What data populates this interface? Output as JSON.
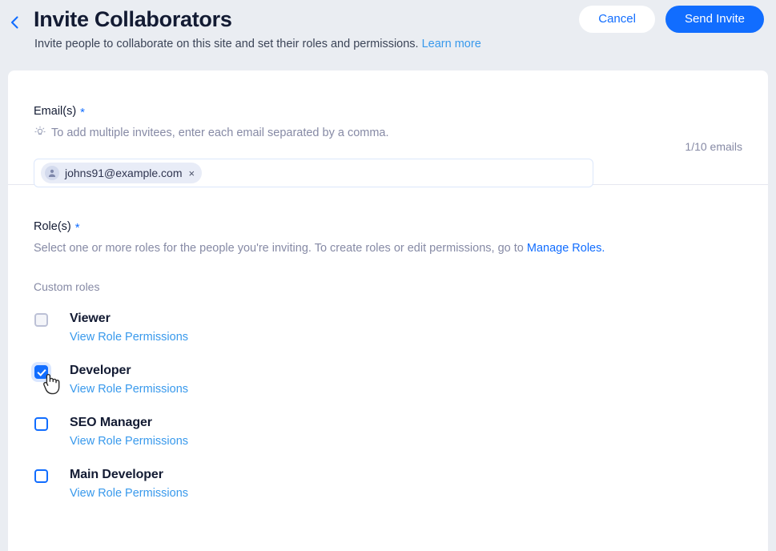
{
  "header": {
    "back_icon": "chevron-left-icon",
    "title": "Invite Collaborators",
    "subtitle": "Invite people to collaborate on this site and set their roles and permissions.",
    "learn_more_label": "Learn more",
    "cancel_label": "Cancel",
    "send_invite_label": "Send Invite"
  },
  "email_section": {
    "label": "Email(s)",
    "required_mark": "*",
    "hint_icon": "lightbulb-icon",
    "hint": "To add multiple invitees, enter each email separated by a comma.",
    "counter": "1/10 emails",
    "input_placeholder": "",
    "chips": [
      {
        "avatar_icon": "person-icon",
        "email": "johns91@example.com",
        "remove_icon": "×"
      }
    ]
  },
  "roles_section": {
    "label": "Role(s)",
    "required_mark": "*",
    "description_prefix": "Select one or more roles for the people you're inviting. To create roles or edit permissions, go to ",
    "manage_roles_label": "Manage Roles.",
    "group_title": "Custom roles",
    "view_permissions_label": "View Role Permissions",
    "roles": [
      {
        "name": "Viewer",
        "checked": false,
        "state": "muted",
        "link": "View Role Permissions"
      },
      {
        "name": "Developer",
        "checked": true,
        "state": "active",
        "link": "View Role Permissions"
      },
      {
        "name": "SEO Manager",
        "checked": false,
        "state": "normal",
        "link": "View Role Permissions"
      },
      {
        "name": "Main Developer",
        "checked": false,
        "state": "normal",
        "link": "View Role Permissions"
      }
    ]
  },
  "colors": {
    "page_bg": "#eaedf2",
    "card_bg": "#ffffff",
    "accent": "#116dff",
    "link": "#3899ec",
    "text": "#131b33",
    "muted": "#868aa5"
  }
}
